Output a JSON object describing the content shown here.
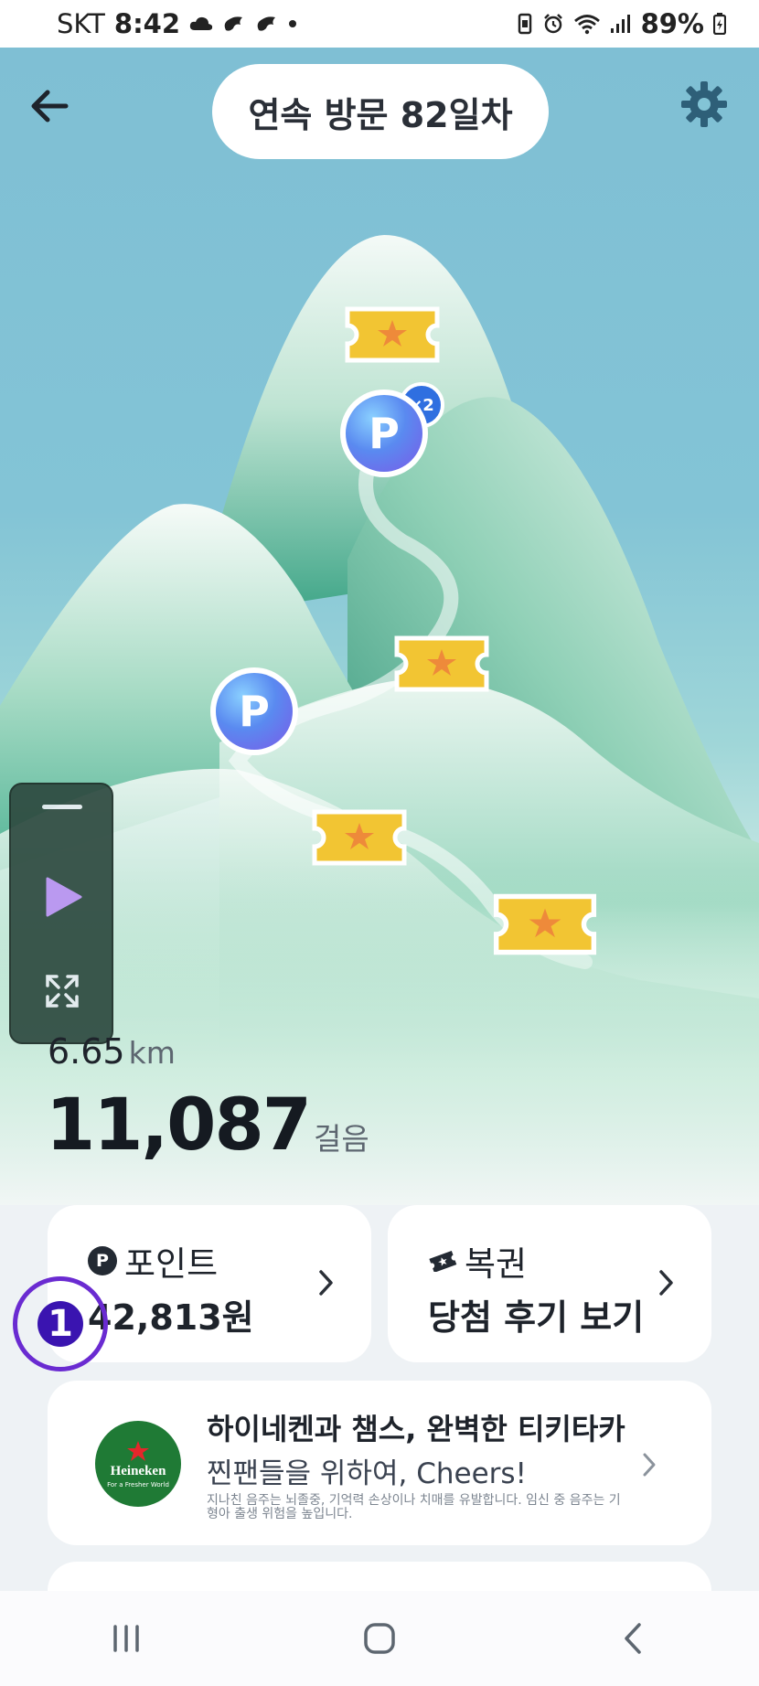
{
  "status_bar": {
    "carrier": "SKT",
    "time": "8:42",
    "battery": "89%"
  },
  "header": {
    "streak_label": "연속 방문 82일차"
  },
  "map": {
    "ticket_multiplier": "×2",
    "point_coin_label": "P"
  },
  "stats": {
    "distance_value": "6.65",
    "distance_unit": "km",
    "steps_value": "11,087",
    "steps_unit": "걸음"
  },
  "points_card": {
    "icon_label": "P",
    "title": "포인트",
    "value": "42,813원"
  },
  "lottery_card": {
    "title": "복권",
    "value": "당첨 후기 보기"
  },
  "step_marker": {
    "number": "1"
  },
  "ad": {
    "logo_brand": "Heineken",
    "logo_tagline": "For a Fresher World",
    "title": "하이네켄과 챔스, 완벽한 티키타카",
    "subtitle": "찐팬들을 위하여, Cheers!",
    "warning": "지나친 음주는 뇌졸중, 기억력 손상이나 치매를 유발합니다. 임신 중 음주는 기형아 출생 위험을 높입니다."
  },
  "colors": {
    "sky": "#83c4d6",
    "mountain": "#3fa58a",
    "ticket": "#f2c533",
    "coin": "#5a8af0",
    "marker": "#6a2bd1"
  },
  "icons": {
    "back": "arrow-left-icon",
    "settings": "gear-icon",
    "play": "play-icon",
    "expand": "expand-icon",
    "lottery": "ticket-icon",
    "chevron": "chevron-right-icon"
  }
}
